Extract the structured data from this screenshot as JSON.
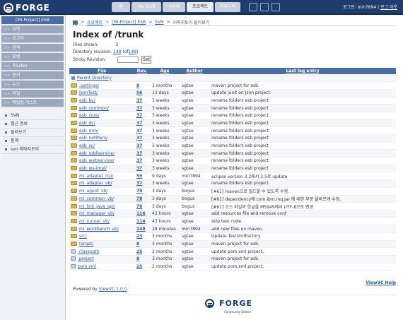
{
  "header": {
    "logo_text": "FORGE",
    "nav_tabs": [
      {
        "label": "홈"
      },
      {
        "label": "My Stuff"
      },
      {
        "label": "사용자"
      },
      {
        "label": "프로젝트"
      },
      {
        "label": "커뮤니티"
      }
    ],
    "login_text": "로그인: min7894 |",
    "logout_label": "로그 아웃"
  },
  "sidebar": {
    "project_name": "[MI-Project] ESB",
    "items": [
      {
        "label": "요약"
      },
      {
        "label": "보고서"
      },
      {
        "label": "검색"
      },
      {
        "label": "포럼"
      },
      {
        "label": "Tracker"
      },
      {
        "label": "문서"
      },
      {
        "label": "뉴스"
      },
      {
        "label": "파일"
      },
      {
        "label": "메일링 리스트"
      }
    ],
    "subitems": [
      {
        "label": "SVN"
      },
      {
        "label": "접근 정보"
      },
      {
        "label": "둘러보기"
      },
      {
        "label": "통계"
      },
      {
        "label": "svn 레파지토리"
      }
    ]
  },
  "breadcrumb": {
    "items": [
      "프로젝트",
      "[MI-Project] ESB",
      "SVN",
      "리파지토리 둘러보기"
    ]
  },
  "main": {
    "title": "Index of /trunk",
    "files_shown_label": "Files shown:",
    "files_shown_value": "3",
    "dir_revision_label": "Directory revision:",
    "dir_revision_value": "148",
    "dir_revision_of": "(of",
    "dir_revision_total": "148",
    "sticky_label": "Sticky Revision:",
    "set_label": "Set"
  },
  "table": {
    "headers": [
      "File",
      "Rev.",
      "Age",
      "Author",
      "Last log entry"
    ],
    "parent_label": "Parent Directory",
    "rows": [
      {
        "file": ".settings/",
        "rev": "8",
        "age": "3 months",
        "author": "sgtae",
        "log": "maven project for esb.",
        "kind": "dir"
      },
      {
        "file": "JsonTest/",
        "rev": "56",
        "age": "13 days",
        "author": "sgtae",
        "log": "update junit on Json project.",
        "kind": "dir"
      },
      {
        "file": "esb_bc/",
        "rev": "37",
        "age": "3 weeks",
        "author": "sgtae",
        "log": "rename folders esb project",
        "kind": "dir"
      },
      {
        "file": "esb_common/",
        "rev": "37",
        "age": "3 weeks",
        "author": "sgtae",
        "log": "rename folders esb project",
        "kind": "dir"
      },
      {
        "file": "esb_core/",
        "rev": "37",
        "age": "3 weeks",
        "author": "sgtae",
        "log": "rename folders esb project",
        "kind": "dir"
      },
      {
        "file": "esb_dc/",
        "rev": "37",
        "age": "3 weeks",
        "author": "sgtae",
        "log": "rename folders esb project",
        "kind": "dir"
      },
      {
        "file": "esb_mm/",
        "rev": "37",
        "age": "3 weeks",
        "author": "sgtae",
        "log": "rename folders esb project",
        "kind": "dir"
      },
      {
        "file": "esb_notifiers/",
        "rev": "37",
        "age": "3 weeks",
        "author": "sgtae",
        "log": "rename folders esb project",
        "kind": "dir"
      },
      {
        "file": "esb_sc/",
        "rev": "37",
        "age": "3 weeks",
        "author": "sgtae",
        "log": "rename folders esb project",
        "kind": "dir"
      },
      {
        "file": "esb_uddiservice/",
        "rev": "37",
        "age": "3 weeks",
        "author": "sgtae",
        "log": "rename folders esb project",
        "kind": "dir"
      },
      {
        "file": "esb_webservice/",
        "rev": "37",
        "age": "3 weeks",
        "author": "sgtae",
        "log": "rename folders esb project",
        "kind": "dir"
      },
      {
        "file": "esb_ws-impl/",
        "rev": "37",
        "age": "3 weeks",
        "author": "sgtae",
        "log": "rename folders esb project",
        "kind": "dir"
      },
      {
        "file": "mi_adapter_rcp/",
        "rev": "59",
        "age": "9 days",
        "author": "min7894",
        "log": "eclipse version 3.2에서 3.5로 update",
        "kind": "dir"
      },
      {
        "file": "mi_adapter_vb/",
        "rev": "37",
        "age": "3 weeks",
        "author": "sgtae",
        "log": "rename folders esb project",
        "kind": "dir"
      },
      {
        "file": "mi_agent_vb/",
        "rev": "79",
        "age": "3 days",
        "author": "bogus",
        "log": "[#61] maven으로 빌드할 수 있도록 수정.",
        "kind": "dir"
      },
      {
        "file": "mi_common_vb/",
        "rev": "78",
        "age": "3 days",
        "author": "bogus",
        "log": "[#61] dependency에 com.ibm.mq.jar 에 대한 부분 올바르게 수정.",
        "kind": "dir"
      },
      {
        "file": "mi_link_java_api/",
        "rev": "76",
        "age": "3 days",
        "author": "bogus",
        "log": "[#61] 소스 파일의 한글을 MS949에서 UTF-8으로 변경",
        "kind": "dir"
      },
      {
        "file": "mi_manager_vb/",
        "rev": "116",
        "age": "43 hours",
        "author": "sgtae",
        "log": "add resources file and remove conf",
        "kind": "dir"
      },
      {
        "file": "mi_runner_vb/",
        "rev": "114",
        "age": "43 hours",
        "author": "sgtae",
        "log": "skip test code.",
        "kind": "dir"
      },
      {
        "file": "mi_workbench_vb/",
        "rev": "148",
        "age": "28 minutes",
        "author": "min7894",
        "log": "add new files on maven.",
        "kind": "dir"
      },
      {
        "file": "src/",
        "rev": "23",
        "age": "3 months",
        "author": "sgtae",
        "log": "Update TestUnitFactory",
        "kind": "dir"
      },
      {
        "file": "target/",
        "rev": "8",
        "age": "3 months",
        "author": "sgtae",
        "log": "maven project for esb.",
        "kind": "dir"
      },
      {
        "file": ".classpath",
        "rev": "25",
        "age": "2 months",
        "author": "sgtae",
        "log": "update pom.xml project,",
        "kind": "file"
      },
      {
        "file": ".project",
        "rev": "8",
        "age": "3 months",
        "author": "sgtae",
        "log": "maven project for esb.",
        "kind": "file"
      },
      {
        "file": "pom.xml",
        "rev": "25",
        "age": "2 months",
        "author": "sgtae",
        "log": "update pom.xml project,",
        "kind": "file"
      }
    ]
  },
  "footer": {
    "powered_prefix": "Powered by",
    "powered_link": "ViewVC 1.0.0",
    "help_label": "ViewVC Help",
    "logo_text": "FORGE",
    "logo_sub": "Community Edition"
  }
}
